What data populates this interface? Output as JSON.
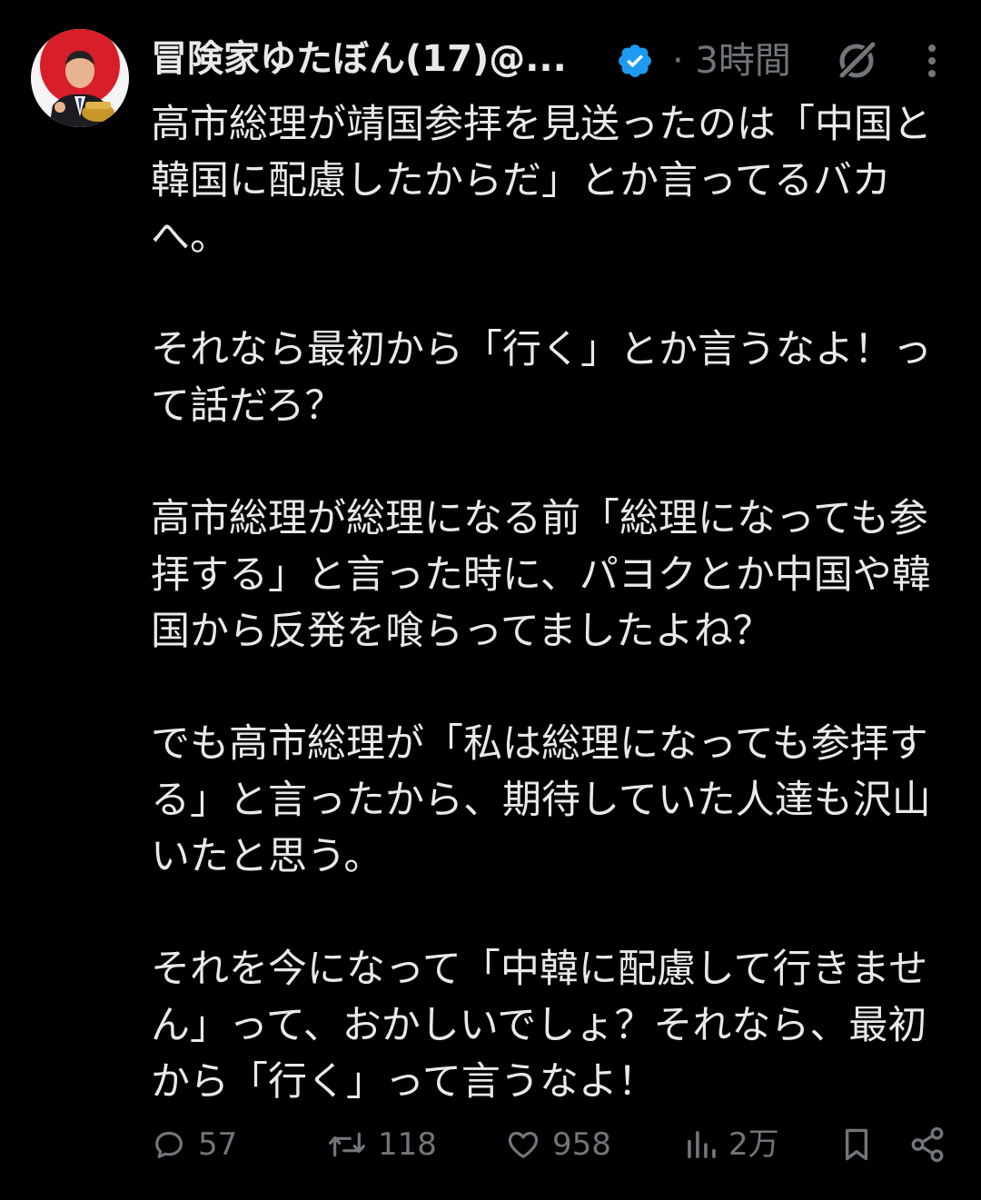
{
  "tweet": {
    "author": {
      "display_name": "冒険家ゆたぼん(17)@...",
      "avatar_icon": "profile-photo",
      "verified_icon": "verified-badge-icon",
      "verified_color": "#1d9bf0"
    },
    "timestamp": "· 3時間",
    "header_icons": [
      "grok-icon",
      "more-vertical-icon"
    ],
    "paragraphs": [
      "高市総理が靖国参拝を見送ったのは「中国と韓国に配慮したからだ」とか言ってるバカへ。",
      "それなら最初から「行く」とか言うなよ！って話だろ？",
      "高市総理が総理になる前「総理になっても参拝する」と言った時に、パヨクとか中国や韓国から反発を喰らってましたよね？",
      "でも高市総理が「私は総理になっても参拝する」と言ったから、期待していた人達も沢山いたと思う。",
      "それを今になって「中韓に配慮して行きません」って、おかしいでしょ？それなら、最初から「行く」って言うなよ！"
    ],
    "actions": {
      "reply": {
        "icon": "reply-icon",
        "count": "57"
      },
      "retweet": {
        "icon": "retweet-icon",
        "count": "118"
      },
      "like": {
        "icon": "heart-icon",
        "count": "958"
      },
      "views": {
        "icon": "views-chart-icon",
        "count": "2万"
      },
      "bookmark": {
        "icon": "bookmark-icon"
      },
      "share": {
        "icon": "share-icon"
      }
    },
    "colors": {
      "background": "#000000",
      "text": "#e7e9ea",
      "secondary": "#71767b"
    }
  }
}
